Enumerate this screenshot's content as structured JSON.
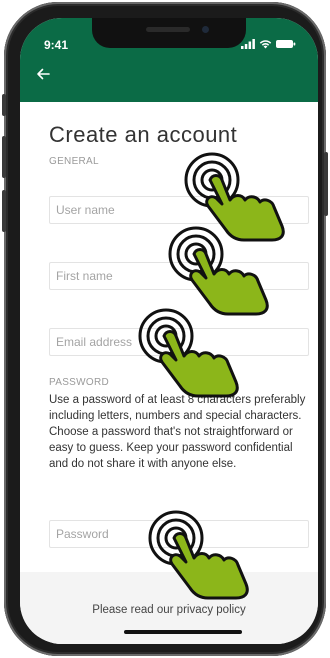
{
  "status_bar": {
    "time": "9:41"
  },
  "header": {
    "back_icon": "arrow-left-icon",
    "color": "#0b6b46"
  },
  "page": {
    "title": "Create an account",
    "general_label": "GENERAL",
    "password_label": "PASSWORD"
  },
  "form": {
    "username_placeholder": "User name",
    "firstname_placeholder": "First name",
    "email_placeholder": "Email address",
    "password_placeholder": "Password"
  },
  "help_text": "Use a password of at least 8 characters preferably including letters, numbers and special characters. Choose a password that's not straightforward or easy to guess. Keep your password confidential and do not share it with anyone else.",
  "footer": {
    "privacy_text": "Please read our privacy policy"
  },
  "overlay": {
    "icon": "tap-hand-icon",
    "color": "#8cb61a"
  }
}
